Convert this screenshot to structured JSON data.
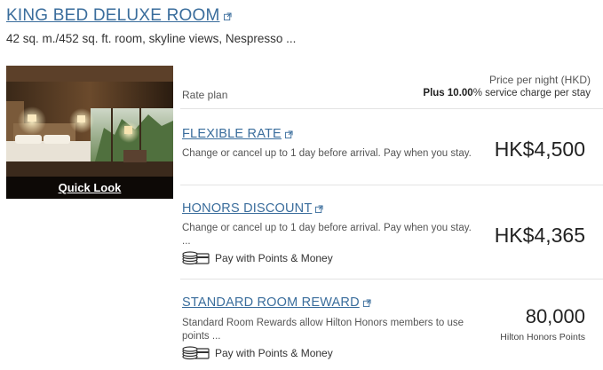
{
  "room": {
    "title": "KING BED DELUXE ROOM",
    "description": "42 sq. m./452 sq. ft. room, skyline views, Nespresso ...",
    "quick_look_label": "Quick Look"
  },
  "rate_table": {
    "rate_plan_header": "Rate plan",
    "price_header": "Price per night (HKD)",
    "service_charge_prefix": "Plus 10.00",
    "service_charge_suffix": "% service charge per stay"
  },
  "rates": [
    {
      "name": "FLEXIBLE RATE",
      "description": "Change or cancel up to 1 day before arrival. Pay when you stay.",
      "price": "HK$4,500",
      "price_sub": "",
      "pay_points_label": ""
    },
    {
      "name": "HONORS DISCOUNT",
      "description": "Change or cancel up to 1 day before arrival. Pay when you stay. ...",
      "price": "HK$4,365",
      "price_sub": "",
      "pay_points_label": "Pay with Points & Money"
    },
    {
      "name": "STANDARD ROOM REWARD",
      "description": "Standard Room Rewards allow Hilton Honors members to use points ...",
      "price": "80,000",
      "price_sub": "Hilton Honors Points",
      "pay_points_label": "Pay with Points & Money"
    }
  ],
  "colors": {
    "link": "#3a6d9c",
    "text": "#333333",
    "divider": "#e3e3e3"
  },
  "icons": {
    "external_link": "external-link-icon",
    "points_money": "coins-card-icon"
  }
}
